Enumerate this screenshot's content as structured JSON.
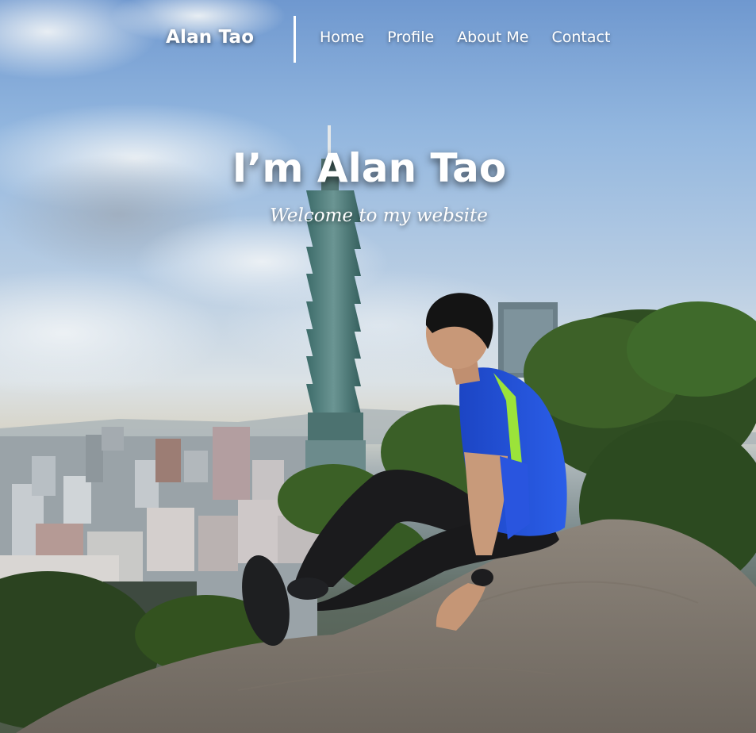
{
  "nav": {
    "brand": "Alan Tao",
    "links": [
      {
        "label": "Home"
      },
      {
        "label": "Profile"
      },
      {
        "label": "About Me"
      },
      {
        "label": "Contact"
      }
    ]
  },
  "hero": {
    "title": "I’m Alan Tao",
    "subtitle": "Welcome to my website"
  },
  "colors": {
    "text": "#ffffff",
    "sky_top": "#6f98cf",
    "jersey_blue": "#1f4fd6",
    "jersey_stripe": "#9be33a"
  }
}
